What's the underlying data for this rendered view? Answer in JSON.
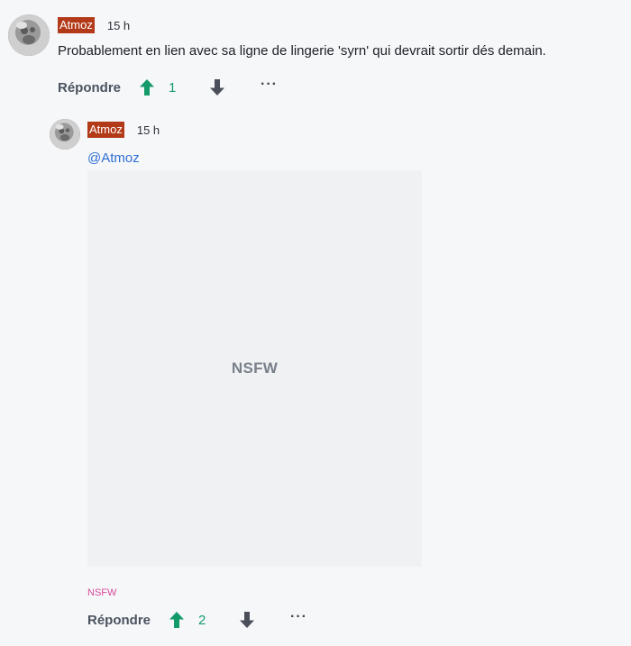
{
  "comments": [
    {
      "username": "Atmoz",
      "time": "15 h",
      "text": "Probablement en lien avec sa ligne de lingerie 'syrn' qui devrait sortir dés demain.",
      "actions": {
        "reply_label": "Répondre",
        "upvotes": "1",
        "more_label": "···"
      }
    },
    {
      "username": "Atmoz",
      "time": "15 h",
      "mention": "@Atmoz",
      "media_label": "NSFW",
      "tag": "NSFW",
      "actions": {
        "reply_label": "Répondre",
        "upvotes": "2",
        "more_label": "···"
      }
    }
  ],
  "colors": {
    "username_bg": "#b33a19",
    "upvote": "#159a6a",
    "mention": "#2f6fd6",
    "nsfw_tag": "#d94a9a"
  },
  "icons": {
    "upvote": "arrow-up-icon",
    "downvote": "arrow-down-icon",
    "more": "more-icon"
  }
}
